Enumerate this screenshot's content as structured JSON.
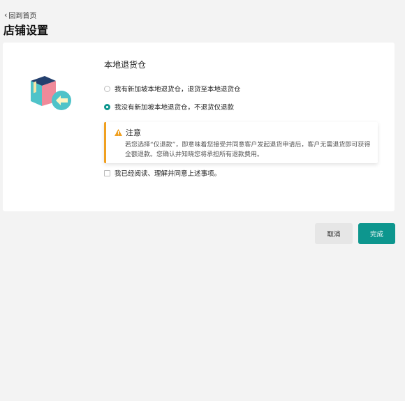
{
  "header": {
    "back_label": "回到首页",
    "title": "店铺设置"
  },
  "section": {
    "title": "本地退货仓"
  },
  "options": [
    {
      "label": "我有新加坡本地退货仓，退货至本地退货仓",
      "selected": false
    },
    {
      "label": "我没有新加坡本地退货仓，不退货仅退款",
      "selected": true
    }
  ],
  "notice": {
    "icon": "warning-icon",
    "title": "注意",
    "body": "若您选择“仅退款”，即意味着您接受并同意客户发起退货申请后，客户无需退货即可获得全额退款。您确认并知晓您将承担所有退款费用。"
  },
  "agreement": {
    "label": "我已经阅读、理解并同意上述事项。",
    "checked": false
  },
  "buttons": {
    "cancel": "取消",
    "done": "完成"
  },
  "colors": {
    "accent": "#0d968e",
    "warning": "#f0a020",
    "background": "#f3f3f3"
  }
}
